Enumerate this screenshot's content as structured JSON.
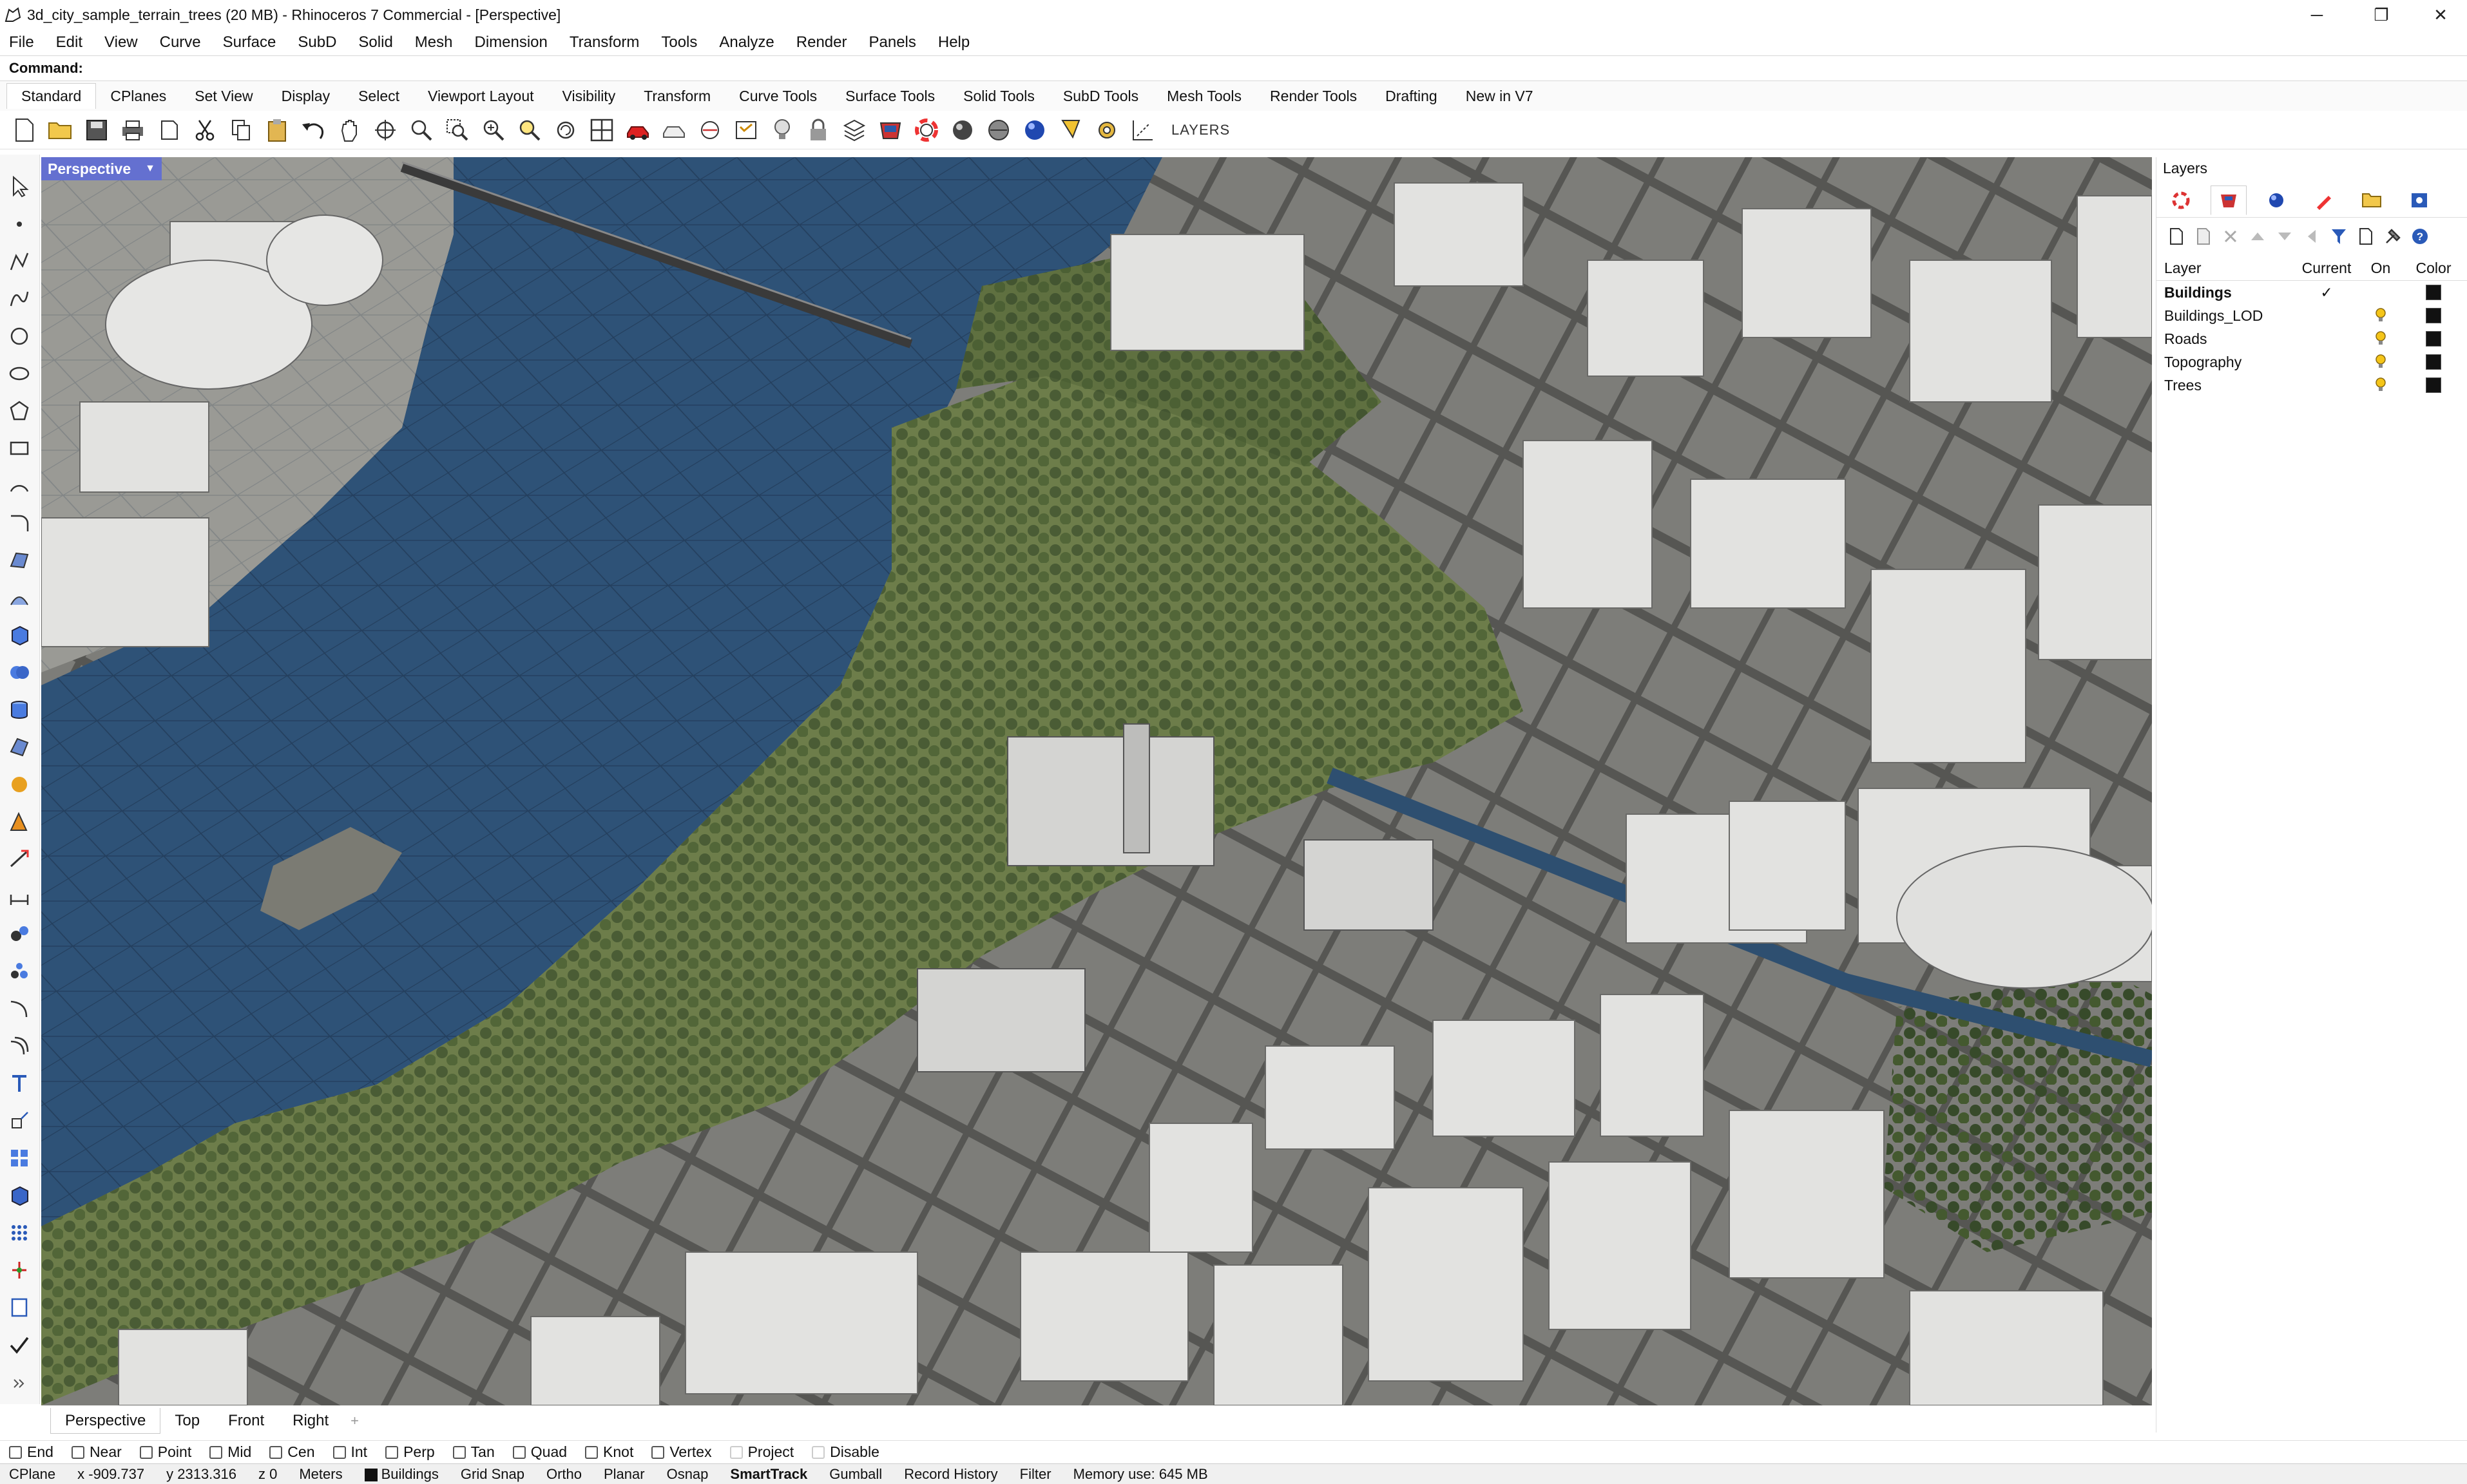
{
  "window": {
    "title": "3d_city_sample_terrain_trees (20 MB) - Rhinoceros 7 Commercial - [Perspective]",
    "minimize": "─",
    "restore": "❐",
    "close": "✕"
  },
  "menu": [
    "File",
    "Edit",
    "View",
    "Curve",
    "Surface",
    "SubD",
    "Solid",
    "Mesh",
    "Dimension",
    "Transform",
    "Tools",
    "Analyze",
    "Render",
    "Panels",
    "Help"
  ],
  "command": {
    "label": "Command:",
    "value": ""
  },
  "toolbar_tabs": [
    "Standard",
    "CPlanes",
    "Set View",
    "Display",
    "Select",
    "Viewport Layout",
    "Visibility",
    "Transform",
    "Curve Tools",
    "Surface Tools",
    "Solid Tools",
    "SubD Tools",
    "Mesh Tools",
    "Render Tools",
    "Drafting",
    "New in V7"
  ],
  "toolbar_active_tab": "Standard",
  "toolbar_layers_label": "LAYERS",
  "toolbar_icons": [
    "new-file-icon",
    "open-file-icon",
    "save-icon",
    "print-icon",
    "import-icon",
    "cut-icon",
    "copy-icon",
    "paste-icon",
    "undo-icon",
    "pan-icon",
    "rotate-view-icon",
    "zoom-icon",
    "zoom-window-icon",
    "zoom-extents-icon",
    "zoom-selected-icon",
    "undo-view-icon",
    "four-viewports-icon",
    "car-shaded-icon",
    "rendered-icon",
    "cplane-icon",
    "properties-icon",
    "lightbulb-icon",
    "lock-icon",
    "layer-color-icon",
    "material-icon",
    "render-icon",
    "sphere-icon",
    "render-preview-icon",
    "light-icon",
    "options-icon",
    "grid-icon"
  ],
  "viewport": {
    "name": "Perspective",
    "tabs": [
      "Perspective",
      "Top",
      "Front",
      "Right"
    ],
    "active_tab": "Perspective",
    "add_tab": "+"
  },
  "layers_panel": {
    "title": "Layers",
    "columns": {
      "name": "Layer",
      "current": "Current",
      "on": "On",
      "color": "Color"
    },
    "rows": [
      {
        "name": "Buildings",
        "current": "✓",
        "on": "",
        "color": "#111111"
      },
      {
        "name": "Buildings_LOD",
        "current": "",
        "on": "💡",
        "color": "#111111"
      },
      {
        "name": "Roads",
        "current": "",
        "on": "💡",
        "color": "#111111"
      },
      {
        "name": "Topography",
        "current": "",
        "on": "💡",
        "color": "#111111"
      },
      {
        "name": "Trees",
        "current": "",
        "on": "💡",
        "color": "#111111"
      }
    ]
  },
  "osnaps": [
    {
      "label": "End",
      "enabled": true
    },
    {
      "label": "Near",
      "enabled": true
    },
    {
      "label": "Point",
      "enabled": true
    },
    {
      "label": "Mid",
      "enabled": true
    },
    {
      "label": "Cen",
      "enabled": true
    },
    {
      "label": "Int",
      "enabled": true
    },
    {
      "label": "Perp",
      "enabled": true
    },
    {
      "label": "Tan",
      "enabled": true
    },
    {
      "label": "Quad",
      "enabled": true
    },
    {
      "label": "Knot",
      "enabled": true
    },
    {
      "label": "Vertex",
      "enabled": true
    },
    {
      "label": "Project",
      "enabled": false
    },
    {
      "label": "Disable",
      "enabled": false
    }
  ],
  "status": {
    "cplane": "CPlane",
    "x": "x -909.737",
    "y": "y 2313.316",
    "z": "z 0",
    "units": "Meters",
    "layer": "Buildings",
    "grid_snap": "Grid Snap",
    "ortho": "Ortho",
    "planar": "Planar",
    "osnap": "Osnap",
    "smarttrack": "SmartTrack",
    "gumball": "Gumball",
    "record_history": "Record History",
    "filter": "Filter",
    "memory": "Memory use: 645 MB"
  },
  "colors": {
    "water": "#2e5277",
    "park": "#6d7d4a",
    "trees": "#3f5230",
    "buildings": "#e2e2e0",
    "roads": "#555553",
    "viewport_label": "#6470d0"
  }
}
